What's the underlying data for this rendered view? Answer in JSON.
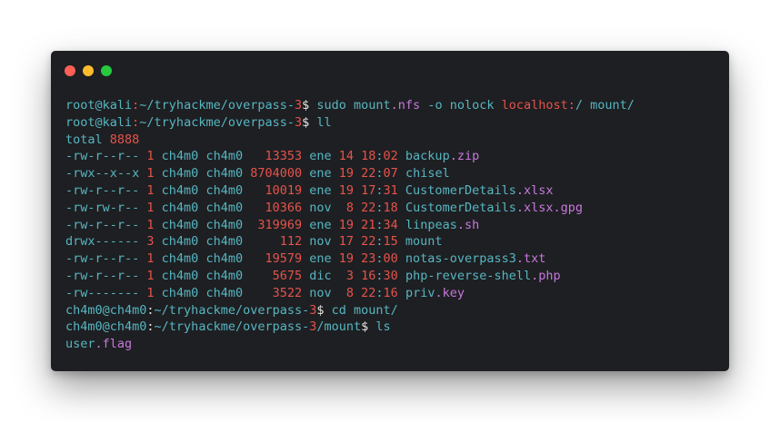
{
  "window": {
    "traffic_lights": [
      {
        "name": "close-dot",
        "color": "#ff5f56"
      },
      {
        "name": "minimize-dot",
        "color": "#ffbd2e"
      },
      {
        "name": "maximize-dot",
        "color": "#27c93f"
      }
    ]
  },
  "colors": {
    "base": "#56b6c2",
    "number": "#e5534b",
    "purple": "#c678dd",
    "white": "#e6e6e6"
  },
  "terminal": {
    "lines": [
      [
        [
          "root@kali",
          "base"
        ],
        [
          ":",
          "number"
        ],
        [
          "~/tryhackme/overpass-",
          "base"
        ],
        [
          "3",
          "number"
        ],
        [
          "$ ",
          "white"
        ],
        [
          "sudo mount",
          "base"
        ],
        [
          ".nfs",
          "purple"
        ],
        [
          " -o nolock ",
          "base"
        ],
        [
          "localhost:",
          "number"
        ],
        [
          "/ mount/",
          "base"
        ]
      ],
      [
        [
          "root@kali",
          "base"
        ],
        [
          ":",
          "number"
        ],
        [
          "~/tryhackme/overpass-",
          "base"
        ],
        [
          "3",
          "number"
        ],
        [
          "$ ",
          "white"
        ],
        [
          "ll",
          "base"
        ]
      ],
      [
        [
          "total ",
          "base"
        ],
        [
          "8888",
          "number"
        ]
      ],
      [
        [
          "-rw-r--r-- ",
          "base"
        ],
        [
          "1",
          "number"
        ],
        [
          " ch4m0 ch4m0   ",
          "base"
        ],
        [
          "13353",
          "number"
        ],
        [
          " ene ",
          "base"
        ],
        [
          "14 18",
          "number"
        ],
        [
          ":",
          "base"
        ],
        [
          "02",
          "number"
        ],
        [
          " backup",
          "base"
        ],
        [
          ".zip",
          "purple"
        ]
      ],
      [
        [
          "-rwx--x--x ",
          "base"
        ],
        [
          "1",
          "number"
        ],
        [
          " ch4m0 ch4m0 ",
          "base"
        ],
        [
          "8704000",
          "number"
        ],
        [
          " ene ",
          "base"
        ],
        [
          "19 22",
          "number"
        ],
        [
          ":",
          "base"
        ],
        [
          "07",
          "number"
        ],
        [
          " chisel",
          "base"
        ]
      ],
      [
        [
          "-rw-r--r-- ",
          "base"
        ],
        [
          "1",
          "number"
        ],
        [
          " ch4m0 ch4m0   ",
          "base"
        ],
        [
          "10019",
          "number"
        ],
        [
          " ene ",
          "base"
        ],
        [
          "19 17",
          "number"
        ],
        [
          ":",
          "base"
        ],
        [
          "31",
          "number"
        ],
        [
          " CustomerDetails",
          "base"
        ],
        [
          ".xlsx",
          "purple"
        ]
      ],
      [
        [
          "-rw-rw-r-- ",
          "base"
        ],
        [
          "1",
          "number"
        ],
        [
          " ch4m0 ch4m0   ",
          "base"
        ],
        [
          "10366",
          "number"
        ],
        [
          " nov  ",
          "base"
        ],
        [
          "8 22",
          "number"
        ],
        [
          ":",
          "base"
        ],
        [
          "18",
          "number"
        ],
        [
          " CustomerDetails",
          "base"
        ],
        [
          ".xlsx",
          "purple"
        ],
        [
          ".gpg",
          "purple"
        ]
      ],
      [
        [
          "-rw-r--r-- ",
          "base"
        ],
        [
          "1",
          "number"
        ],
        [
          " ch4m0 ch4m0  ",
          "base"
        ],
        [
          "319969",
          "number"
        ],
        [
          " ene ",
          "base"
        ],
        [
          "19 21",
          "number"
        ],
        [
          ":",
          "base"
        ],
        [
          "34",
          "number"
        ],
        [
          " linpeas",
          "base"
        ],
        [
          ".sh",
          "purple"
        ]
      ],
      [
        [
          "drwx------ ",
          "base"
        ],
        [
          "3",
          "number"
        ],
        [
          " ch4m0 ch4m0     ",
          "base"
        ],
        [
          "112",
          "number"
        ],
        [
          " nov ",
          "base"
        ],
        [
          "17 22",
          "number"
        ],
        [
          ":",
          "base"
        ],
        [
          "15",
          "number"
        ],
        [
          " mount",
          "base"
        ]
      ],
      [
        [
          "-rw-r--r-- ",
          "base"
        ],
        [
          "1",
          "number"
        ],
        [
          " ch4m0 ch4m0   ",
          "base"
        ],
        [
          "19579",
          "number"
        ],
        [
          " ene ",
          "base"
        ],
        [
          "19 23",
          "number"
        ],
        [
          ":",
          "base"
        ],
        [
          "00",
          "number"
        ],
        [
          " notas-overpass3",
          "base"
        ],
        [
          ".txt",
          "purple"
        ]
      ],
      [
        [
          "-rw-r--r-- ",
          "base"
        ],
        [
          "1",
          "number"
        ],
        [
          " ch4m0 ch4m0    ",
          "base"
        ],
        [
          "5675",
          "number"
        ],
        [
          " dic  ",
          "base"
        ],
        [
          "3 16",
          "number"
        ],
        [
          ":",
          "base"
        ],
        [
          "30",
          "number"
        ],
        [
          " php-reverse-shell",
          "base"
        ],
        [
          ".php",
          "purple"
        ]
      ],
      [
        [
          "-rw------- ",
          "base"
        ],
        [
          "1",
          "number"
        ],
        [
          " ch4m0 ch4m0    ",
          "base"
        ],
        [
          "3522",
          "number"
        ],
        [
          " nov  ",
          "base"
        ],
        [
          "8 22",
          "number"
        ],
        [
          ":",
          "base"
        ],
        [
          "16",
          "number"
        ],
        [
          " priv",
          "base"
        ],
        [
          ".key",
          "purple"
        ]
      ],
      [
        [
          "ch4m0@ch4m0",
          "base"
        ],
        [
          ":",
          "white"
        ],
        [
          "~/tryhackme/overpass-",
          "base"
        ],
        [
          "3",
          "number"
        ],
        [
          "$ ",
          "white"
        ],
        [
          "cd mount/",
          "base"
        ]
      ],
      [
        [
          "ch4m0@ch4m0",
          "base"
        ],
        [
          ":",
          "white"
        ],
        [
          "~/tryhackme/overpass-",
          "base"
        ],
        [
          "3",
          "number"
        ],
        [
          "/mount",
          "base"
        ],
        [
          "$ ",
          "white"
        ],
        [
          "ls",
          "base"
        ]
      ],
      [
        [
          "user",
          "base"
        ],
        [
          ".flag",
          "purple"
        ]
      ]
    ]
  }
}
